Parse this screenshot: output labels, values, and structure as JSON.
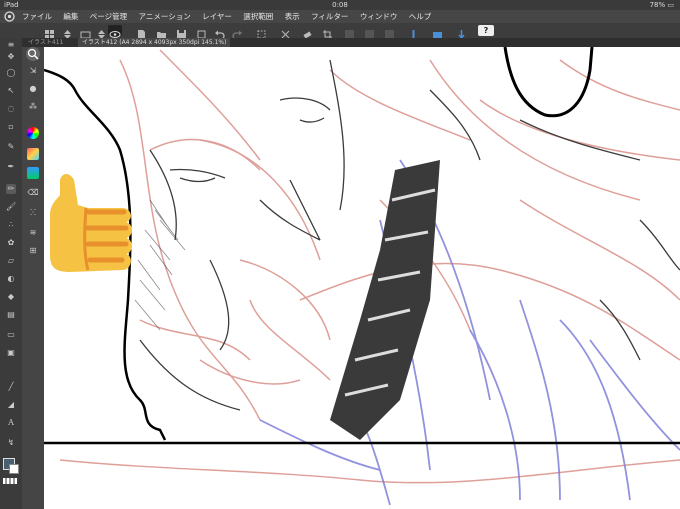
{
  "status_bar": {
    "device": "iPad",
    "time": "0:08",
    "battery": "78%"
  },
  "menu": {
    "items": [
      "ファイル",
      "編集",
      "ページ管理",
      "アニメーション",
      "レイヤー",
      "選択範囲",
      "表示",
      "フィルター",
      "ウィンドウ",
      "ヘルプ"
    ]
  },
  "tabs": [
    {
      "label": "イラスト411"
    },
    {
      "label": "イラスト412 (A4 2894 x 4093px 350dpi 145.1%)"
    }
  ],
  "toolbar": {
    "help_label": "?"
  },
  "colors": {
    "accent": "#4a90d9",
    "line_red": "#d98f87",
    "line_blue": "#7f7fd9",
    "line_dark": "#3b3b3b",
    "emoji_yellow": "#f6c244",
    "emoji_orange": "#e8902b"
  },
  "canvas": {
    "overlay_icon": "thumbs-up-icon"
  }
}
